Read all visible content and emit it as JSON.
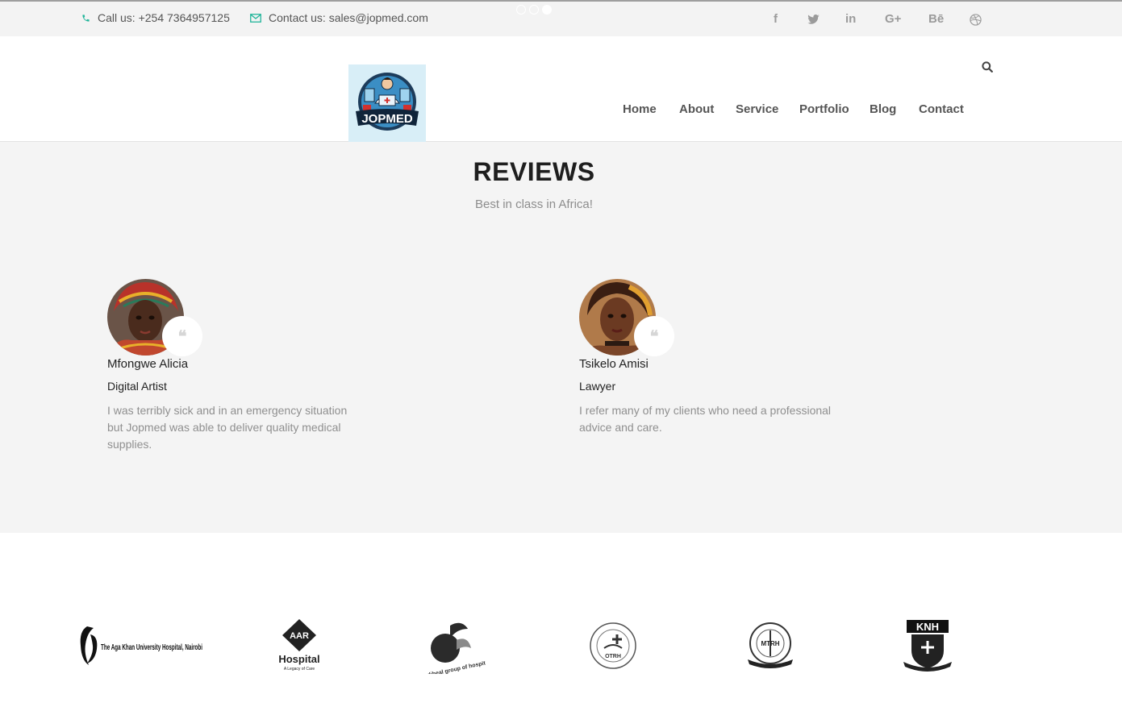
{
  "topbar": {
    "phone": "Call us: +254 7364957125",
    "email": "Contact us: sales@jopmed.com",
    "social": [
      "f",
      "t",
      "in",
      "G+",
      "Bē",
      "dribbble"
    ]
  },
  "header": {
    "logo_text": "JOPMED",
    "nav": [
      "Home",
      "About",
      "Service",
      "Portfolio",
      "Blog",
      "Contact"
    ]
  },
  "reviews": {
    "title": "REVIEWS",
    "subtitle": "Best in class in Africa!",
    "items": [
      {
        "name": "Mfongwe Alicia",
        "role": "Digital Artist",
        "text": "I was terribly sick and in an emergency situation but Jopmed was able to deliver quality medical supplies."
      },
      {
        "name": "Tsikelo Amisi",
        "role": "Lawyer",
        "text": "I refer many of my clients who need a professional advice and care."
      }
    ]
  },
  "partners": {
    "aga_khan": "The Aga Khan University Hospital, Nairobi",
    "aar": "AAR",
    "aar_hospital": "Hospital",
    "aar_tagline": "A Legacy of Care",
    "mediheal": "mediheal group of hospitals",
    "otrh": "OTRH",
    "mtrh": "MTRH",
    "knh": "KNH"
  },
  "colors": {
    "accent": "#21b59a",
    "topbar_bg": "#f3f3f3",
    "section_bg": "#f4f4f4"
  }
}
